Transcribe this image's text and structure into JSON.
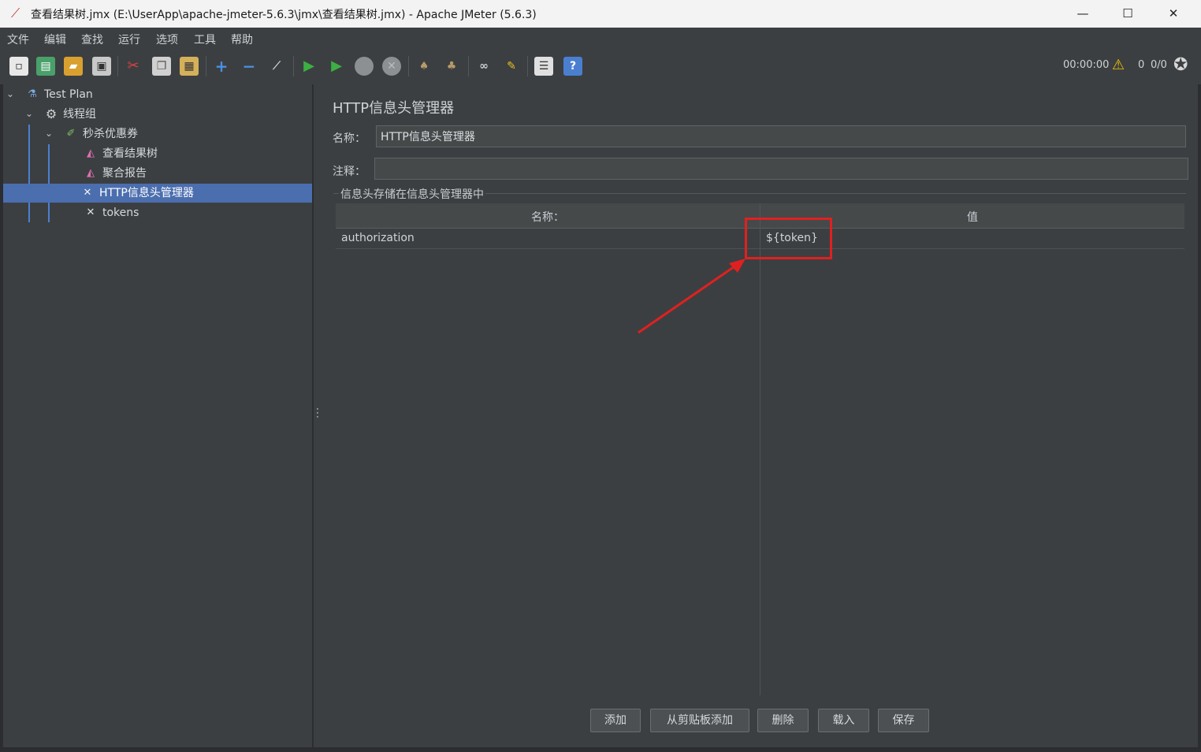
{
  "window": {
    "title": "查看结果树.jmx (E:\\UserApp\\apache-jmeter-5.6.3\\jmx\\查看结果树.jmx) - Apache JMeter (5.6.3)",
    "minimize": "—",
    "maximize": "☐",
    "close": "✕"
  },
  "menu": [
    "文件",
    "编辑",
    "查找",
    "运行",
    "选项",
    "工具",
    "帮助"
  ],
  "status": {
    "timer": "00:00:00",
    "warnings": "0",
    "threads": "0/0"
  },
  "tree": {
    "items": [
      {
        "label": "Test Plan",
        "icon": "flask-icon"
      },
      {
        "label": "线程组",
        "icon": "gear-icon"
      },
      {
        "label": "秒杀优惠券",
        "icon": "pipette-icon"
      },
      {
        "label": "查看结果树",
        "icon": "graph-icon"
      },
      {
        "label": "聚合报告",
        "icon": "graph-icon"
      },
      {
        "label": "HTTP信息头管理器",
        "icon": "wrench-icon"
      },
      {
        "label": "tokens",
        "icon": "wrench-icon"
      }
    ]
  },
  "panel": {
    "title": "HTTP信息头管理器",
    "name_label": "名称：",
    "name_value": "HTTP信息头管理器",
    "comment_label": "注释：",
    "comment_value": "",
    "group_title": "信息头存储在信息头管理器中",
    "table": {
      "columns": [
        "名称：",
        "值"
      ],
      "rows": [
        {
          "name": "authorization",
          "value": "${token}"
        }
      ]
    },
    "buttons": {
      "add": "添加",
      "add_clipboard": "从剪贴板添加",
      "delete": "删除",
      "load": "载入",
      "save": "保存"
    }
  },
  "annotation": {
    "box_color": "#e02020",
    "arrow_color": "#e02020"
  }
}
